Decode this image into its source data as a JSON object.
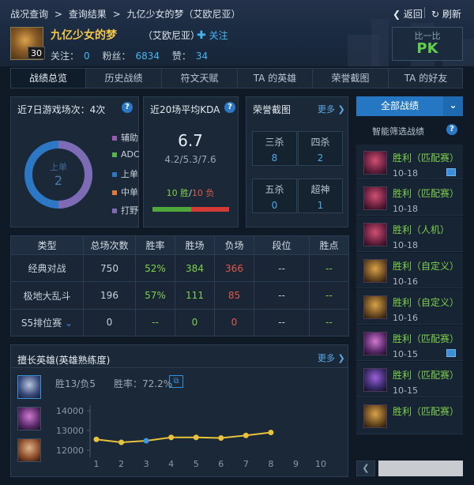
{
  "breadcrumb": [
    "战况查询",
    ">",
    "查询结果",
    ">",
    "九亿少女的梦（艾欧尼亚）"
  ],
  "nav": {
    "back": "返回",
    "refresh": "刷新"
  },
  "profile": {
    "name": "九亿少女的梦",
    "server": "（艾欧尼亚）",
    "follow": "关注",
    "level": "30",
    "follow_label": "关注：",
    "follow_count": "0",
    "fans_label": "粉丝：",
    "fans_count": "6834",
    "likes_label": "赞：",
    "likes_count": "34"
  },
  "pk": {
    "label": "比一比",
    "button": "PK"
  },
  "tabs": [
    "战绩总览",
    "历史战绩",
    "符文天赋",
    "TA 的英雄",
    "荣誉截图",
    "TA 的好友"
  ],
  "recent7": {
    "title": "近7日游戏场次：4次",
    "center_role": "上单",
    "center_count": "2",
    "legend": [
      {
        "label": "辅助",
        "color": "#9b59b6"
      },
      {
        "label": "ADC",
        "color": "#58b44a"
      },
      {
        "label": "上单",
        "color": "#2d78c4"
      },
      {
        "label": "中单",
        "color": "#e07a3a"
      },
      {
        "label": "打野",
        "color": "#7d6bb5"
      }
    ],
    "donut": {
      "上单": 2,
      "打野": 2
    }
  },
  "kda": {
    "title": "近20场平均KDA",
    "value": "6.7",
    "detail": "4.2/5.3/7.6",
    "wins": "10 胜",
    "sep": "/",
    "losses": "10 负",
    "win_ratio": 0.5
  },
  "honor": {
    "title": "荣誉截图",
    "more": "更多",
    "items": [
      {
        "label": "三杀",
        "count": "8"
      },
      {
        "label": "四杀",
        "count": "2"
      },
      {
        "label": "五杀",
        "count": "0"
      },
      {
        "label": "超神",
        "count": "1"
      }
    ]
  },
  "table": {
    "headers": [
      "类型",
      "总场次数",
      "胜率",
      "胜场",
      "负场",
      "段位",
      "胜点"
    ],
    "rows": [
      [
        "经典对战",
        "750",
        "52%",
        "384",
        "366",
        "--",
        "--"
      ],
      [
        "极地大乱斗",
        "196",
        "57%",
        "111",
        "85",
        "--",
        "--"
      ],
      [
        "S5排位赛",
        "0",
        "--",
        "0",
        "0",
        "--",
        "--"
      ]
    ]
  },
  "heroes": {
    "title": "擅长英雄(英雄熟练度)",
    "more": "更多",
    "record": "胜13/负5",
    "winrate": "胜率：72.2%"
  },
  "chart_data": {
    "type": "line",
    "x": [
      1,
      2,
      3,
      4,
      5,
      6,
      7,
      8
    ],
    "values": [
      12550,
      12400,
      12480,
      12650,
      12650,
      12620,
      12750,
      12900
    ],
    "xticks": [
      "1",
      "2",
      "3",
      "4",
      "5",
      "6",
      "7",
      "8",
      "9",
      "10"
    ],
    "yticks": [
      "14000",
      "13000",
      "12000"
    ],
    "ylim": [
      11800,
      14200
    ],
    "xlim": [
      1,
      10
    ],
    "grid": false,
    "color": "#e8c23a",
    "highlight_index": 2
  },
  "sidebar": {
    "all_btn": "全部战绩",
    "smart": "智能筛选战绩",
    "matches": [
      {
        "result": "胜利（匹配赛）",
        "date": "10-18",
        "has_pic": true
      },
      {
        "result": "胜利（匹配赛）",
        "date": "10-18",
        "has_pic": false
      },
      {
        "result": "胜利（人机）",
        "date": "10-18",
        "has_pic": false
      },
      {
        "result": "胜利（自定义）",
        "date": "10-16",
        "has_pic": false
      },
      {
        "result": "胜利（自定义）",
        "date": "10-16",
        "has_pic": false
      },
      {
        "result": "胜利（匹配赛）",
        "date": "10-15",
        "has_pic": true
      },
      {
        "result": "胜利（匹配赛）",
        "date": "10-15",
        "has_pic": false
      },
      {
        "result": "胜利（匹配赛）",
        "date": "",
        "has_pic": false
      }
    ]
  }
}
